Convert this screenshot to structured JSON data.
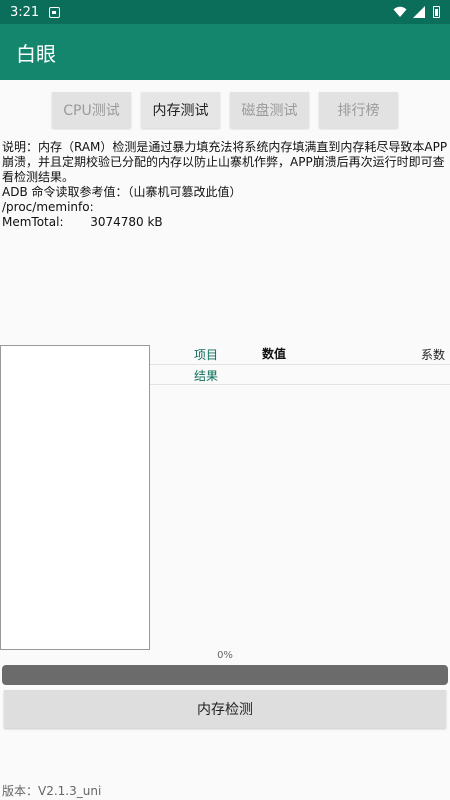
{
  "status_bar": {
    "time": "3:21",
    "icons": [
      "notification-icon",
      "wifi-icon",
      "signal-icon",
      "battery-icon"
    ]
  },
  "app": {
    "title": "白眼"
  },
  "tabs": [
    {
      "label": "CPU测试",
      "active": false
    },
    {
      "label": "内存测试",
      "active": true
    },
    {
      "label": "磁盘测试",
      "active": false
    },
    {
      "label": "排行榜",
      "active": false
    }
  ],
  "description": {
    "line1": "说明：内存（RAM）检测是通过暴力填充法将系统内存填满直到内存耗尽导致本APP崩溃，并且定期校验已分配的内存以防止山寨机作弊，APP崩溃后再次运行时即可查看检测结果。",
    "line2": "ADB 命令读取参考值：（山寨机可篡改此值）",
    "line3": "/proc/meminfo:",
    "line4": "MemTotal:       3074780 kB"
  },
  "table": {
    "header_item": "项目",
    "header_value": "数值",
    "header_coef": "系数",
    "row_result": "结果"
  },
  "progress": {
    "label": "0%",
    "value": 0
  },
  "action": {
    "label": "内存检测"
  },
  "footer": {
    "version": "版本：V2.1.3_uni"
  },
  "colors": {
    "status_bar": "#0b6e5a",
    "app_bar": "#14866d",
    "accent_text": "#0b6e5a",
    "progress_track": "#6b6b6b"
  }
}
